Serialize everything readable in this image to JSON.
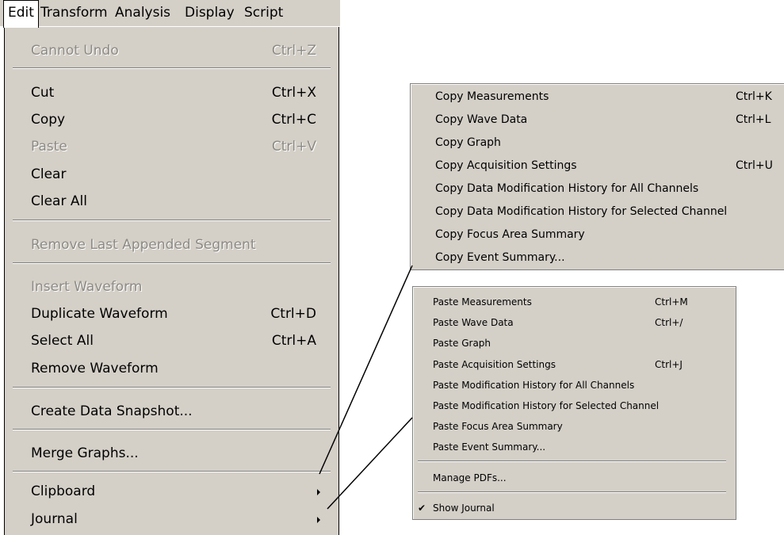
{
  "menubar": {
    "items": [
      "Edit",
      "Transform",
      "Analysis",
      "Display",
      "Script"
    ]
  },
  "edit_menu": {
    "items": [
      {
        "label": "Cannot Undo",
        "shortcut": "Ctrl+Z",
        "disabled": true
      },
      {
        "label": "Cut",
        "shortcut": "Ctrl+X"
      },
      {
        "label": "Copy",
        "shortcut": "Ctrl+C"
      },
      {
        "label": "Paste",
        "shortcut": "Ctrl+V",
        "disabled": true
      },
      {
        "label": "Clear",
        "shortcut": ""
      },
      {
        "label": "Clear All",
        "shortcut": ""
      },
      {
        "label": "Remove Last Appended Segment",
        "shortcut": "",
        "disabled": true
      },
      {
        "label": "Insert Waveform",
        "shortcut": "",
        "disabled": true
      },
      {
        "label": "Duplicate Waveform",
        "shortcut": "Ctrl+D"
      },
      {
        "label": "Select All",
        "shortcut": "Ctrl+A"
      },
      {
        "label": "Remove Waveform",
        "shortcut": ""
      },
      {
        "label": "Create Data Snapshot...",
        "shortcut": ""
      },
      {
        "label": "Merge Graphs...",
        "shortcut": ""
      },
      {
        "label": "Clipboard",
        "shortcut": "",
        "submenu": true
      },
      {
        "label": "Journal",
        "shortcut": "",
        "submenu": true
      }
    ]
  },
  "clipboard_submenu": {
    "items": [
      {
        "label": "Copy Measurements",
        "shortcut": "Ctrl+K"
      },
      {
        "label": "Copy Wave Data",
        "shortcut": "Ctrl+L"
      },
      {
        "label": "Copy Graph",
        "shortcut": ""
      },
      {
        "label": "Copy Acquisition Settings",
        "shortcut": "Ctrl+U"
      },
      {
        "label": "Copy Data Modification History for All Channels",
        "shortcut": ""
      },
      {
        "label": "Copy Data Modification History for Selected Channel",
        "shortcut": ""
      },
      {
        "label": "Copy Focus Area Summary",
        "shortcut": ""
      },
      {
        "label": "Copy Event Summary...",
        "shortcut": ""
      }
    ]
  },
  "journal_submenu": {
    "items": [
      {
        "label": "Paste Measurements",
        "shortcut": "Ctrl+M"
      },
      {
        "label": "Paste Wave Data",
        "shortcut": "Ctrl+/"
      },
      {
        "label": "Paste Graph",
        "shortcut": ""
      },
      {
        "label": "Paste Acquisition Settings",
        "shortcut": "Ctrl+J"
      },
      {
        "label": "Paste Modification History for All Channels",
        "shortcut": ""
      },
      {
        "label": "Paste Modification History for Selected Channel",
        "shortcut": ""
      },
      {
        "label": "Paste Focus Area Summary",
        "shortcut": ""
      },
      {
        "label": "Paste Event Summary...",
        "shortcut": ""
      },
      {
        "label": "Manage PDFs...",
        "shortcut": ""
      },
      {
        "label": "Show Journal",
        "shortcut": "",
        "checked": true
      }
    ]
  },
  "glyphs": {
    "check": "✔"
  }
}
